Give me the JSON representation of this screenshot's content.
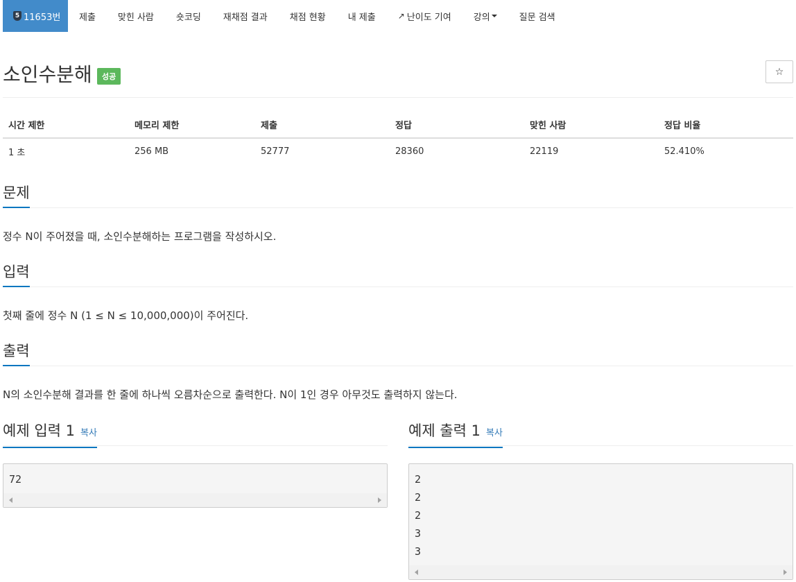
{
  "nav": {
    "tier_number": "5",
    "problem_number": "11653번",
    "tabs": [
      "제출",
      "맞힌 사람",
      "숏코딩",
      "재채점 결과",
      "채점 현황",
      "내 제출",
      "난이도 기여",
      "강의",
      "질문 검색"
    ]
  },
  "problem": {
    "title": "소인수분해",
    "status_badge": "성공",
    "star_icon": "☆"
  },
  "info_table": {
    "headers": [
      "시간 제한",
      "메모리 제한",
      "제출",
      "정답",
      "맞힌 사람",
      "정답 비율"
    ],
    "values": [
      "1 초",
      "256 MB",
      "52777",
      "28360",
      "22119",
      "52.410%"
    ]
  },
  "sections": {
    "problem_title": "문제",
    "problem_text": "정수 N이 주어졌을 때, 소인수분해하는 프로그램을 작성하시오.",
    "input_title": "입력",
    "input_text": "첫째 줄에 정수 N (1 ≤ N ≤ 10,000,000)이 주어진다.",
    "output_title": "출력",
    "output_text": "N의 소인수분해 결과를 한 줄에 하나씩 오름차순으로 출력한다. N이 1인 경우 아무것도 출력하지 않는다."
  },
  "samples": {
    "input_title": "예제 입력 1",
    "output_title": "예제 출력 1",
    "copy_label": "복사",
    "input_lines": [
      "72"
    ],
    "output_lines": [
      "2",
      "2",
      "2",
      "3",
      "3"
    ]
  },
  "colors": {
    "active_tab": "#428bca",
    "success_badge": "#5cb85c",
    "section_underline": "#0076c0",
    "link": "#337ab7"
  }
}
